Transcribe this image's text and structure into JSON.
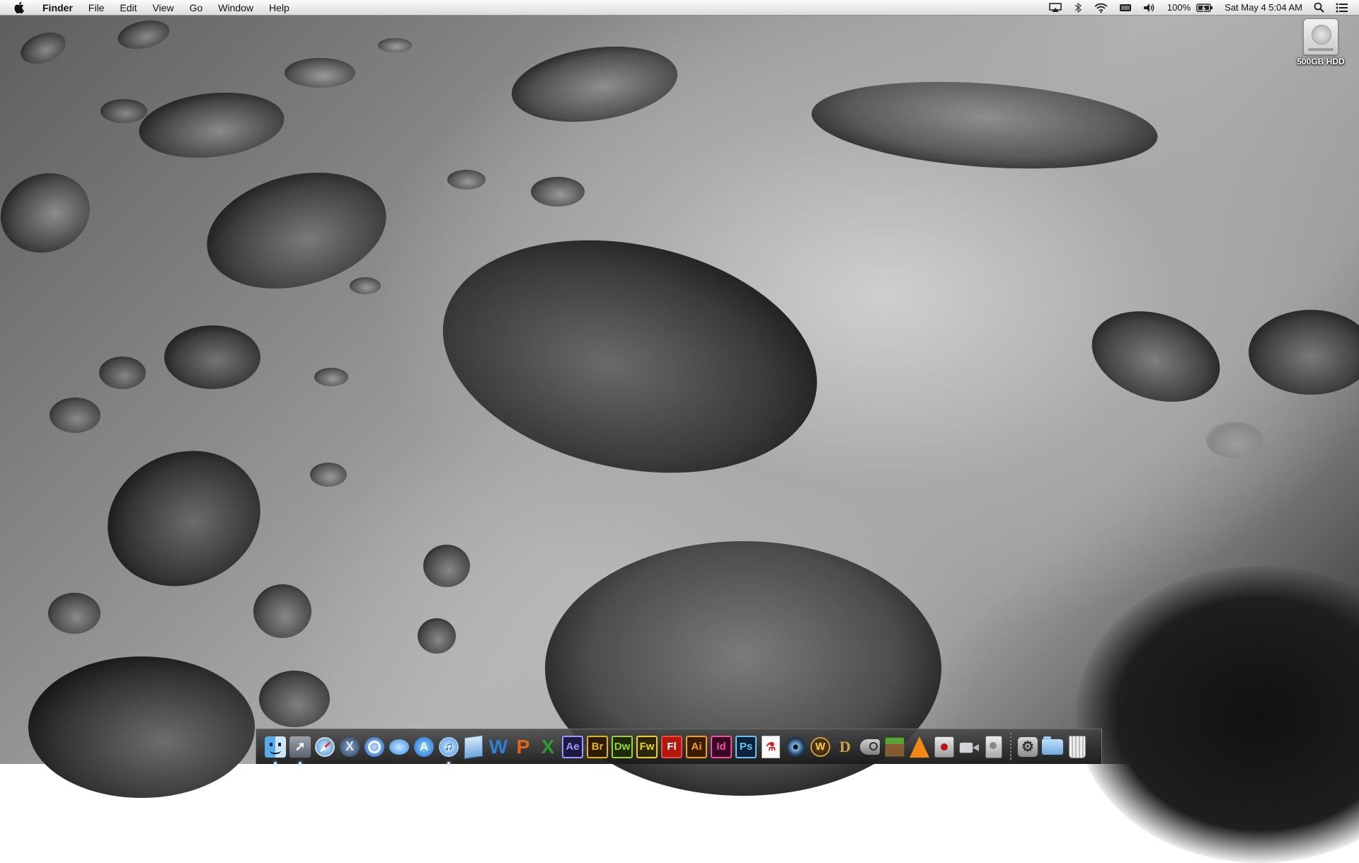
{
  "menubar": {
    "app_name": "Finder",
    "menus": [
      "File",
      "Edit",
      "View",
      "Go",
      "Window",
      "Help"
    ],
    "battery_percent": "100%",
    "datetime": "Sat May 4  5:04 AM"
  },
  "desktop": {
    "icons": [
      {
        "label": "500GB HDD",
        "icon": "hard-disk-icon"
      }
    ]
  },
  "dock": {
    "items": [
      {
        "name": "Finder",
        "icon": "finder-icon",
        "running": true
      },
      {
        "name": "Launchpad",
        "icon": "launchpad-icon",
        "running": true
      },
      {
        "name": "Safari",
        "icon": "safari-icon"
      },
      {
        "name": "Mission Control",
        "icon": "mission-control-icon"
      },
      {
        "name": "QuickTime Player",
        "icon": "quicktime-icon"
      },
      {
        "name": "Messages",
        "icon": "messages-icon"
      },
      {
        "name": "App Store",
        "icon": "app-store-icon"
      },
      {
        "name": "iTunes",
        "icon": "itunes-icon",
        "running": true
      },
      {
        "name": "Dropbox",
        "icon": "dropbox-icon"
      },
      {
        "name": "Word",
        "icon": "word-icon",
        "glyph": "W",
        "color": "#2f7fd4"
      },
      {
        "name": "PowerPoint",
        "icon": "powerpoint-icon",
        "glyph": "P",
        "color": "#e2651b"
      },
      {
        "name": "Excel",
        "icon": "excel-icon",
        "glyph": "X",
        "color": "#2f9a3a"
      },
      {
        "name": "After Effects",
        "icon": "after-effects-icon",
        "glyph": "Ae",
        "color": "#9b9bff",
        "bg": "#1d1940"
      },
      {
        "name": "Bridge",
        "icon": "bridge-icon",
        "glyph": "Br",
        "color": "#e6b21a",
        "bg": "#2b1d04"
      },
      {
        "name": "Dreamweaver",
        "icon": "dreamweaver-icon",
        "glyph": "Dw",
        "color": "#9cd436",
        "bg": "#1f2a08"
      },
      {
        "name": "Fireworks",
        "icon": "fireworks-icon",
        "glyph": "Fw",
        "color": "#ecd21c",
        "bg": "#2b2604"
      },
      {
        "name": "Flash",
        "icon": "flash-icon",
        "glyph": "Fl",
        "color": "#ffffff",
        "bg": "#b3170f"
      },
      {
        "name": "Illustrator",
        "icon": "illustrator-icon",
        "glyph": "Ai",
        "color": "#f7a21b",
        "bg": "#3a1d02"
      },
      {
        "name": "InDesign",
        "icon": "indesign-icon",
        "glyph": "Id",
        "color": "#ee4ea0",
        "bg": "#3a0823"
      },
      {
        "name": "Photoshop",
        "icon": "photoshop-icon",
        "glyph": "Ps",
        "color": "#6ec3f5",
        "bg": "#0b2338"
      },
      {
        "name": "Acrobat",
        "icon": "acrobat-icon"
      },
      {
        "name": "DVD Player",
        "icon": "dvd-player-icon"
      },
      {
        "name": "World of Warcraft",
        "icon": "warcraft-icon",
        "glyph": "W"
      },
      {
        "name": "Diablo III",
        "icon": "diablo-icon",
        "glyph": "D"
      },
      {
        "name": "Steam",
        "icon": "steam-icon"
      },
      {
        "name": "Minecraft",
        "icon": "minecraft-icon"
      },
      {
        "name": "VLC",
        "icon": "vlc-icon"
      },
      {
        "name": "Photo Booth",
        "icon": "photo-booth-icon"
      },
      {
        "name": "Facetime",
        "icon": "video-camera-icon"
      },
      {
        "name": "Disk Utility",
        "icon": "disk-utility-icon"
      },
      {
        "name": "System Preferences",
        "icon": "system-preferences-icon"
      },
      {
        "name": "Documents",
        "icon": "folder-icon"
      },
      {
        "name": "Trash",
        "icon": "trash-icon"
      }
    ]
  }
}
